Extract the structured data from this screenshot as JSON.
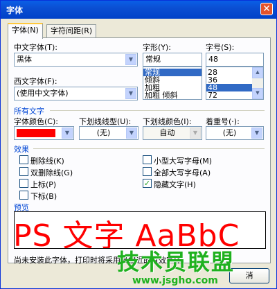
{
  "window": {
    "title": "字体",
    "close_glyph": "✕"
  },
  "tabs": [
    {
      "label": "字体(N)"
    },
    {
      "label": "字符间距(R)"
    }
  ],
  "chinese_font": {
    "label": "中文字体(T):",
    "value": "黑体"
  },
  "western_font": {
    "label": "西文字体(F):",
    "value": "(使用中文字体)"
  },
  "style": {
    "label": "字形(Y):",
    "value": "常规",
    "options": [
      "常规",
      "倾斜",
      "加粗",
      "加粗 倾斜"
    ],
    "selected": "常规"
  },
  "size": {
    "label": "字号(S):",
    "value": "48",
    "options": [
      "28",
      "36",
      "48",
      "72"
    ],
    "selected": "48"
  },
  "all_text": {
    "title": "所有文字",
    "font_color_label": "字体颜色(C):",
    "font_color_value": "#ff0000",
    "underline_style_label": "下划线线型(U):",
    "underline_style_value": "(无)",
    "underline_color_label": "下划线颜色(I):",
    "underline_color_value": "自动",
    "emphasis_label": "着重号(·):",
    "emphasis_value": "(无)"
  },
  "effects": {
    "title": "效果",
    "items": [
      {
        "label": "删除线(K)",
        "checked": false
      },
      {
        "label": "双删除线(G)",
        "checked": false
      },
      {
        "label": "上标(P)",
        "checked": false
      },
      {
        "label": "下标(B)",
        "checked": false
      },
      {
        "label": "小型大写字母(M)",
        "checked": false
      },
      {
        "label": "全部大写字母(A)",
        "checked": false
      },
      {
        "label": "隐藏文字(H)",
        "checked": true
      }
    ]
  },
  "preview": {
    "title": "预览",
    "text": "PS 文字 AaBbC"
  },
  "note": "尚未安装此字体，打印时将采用最相近的有效字体。",
  "buttons": {
    "cancel": "消"
  },
  "watermark": {
    "brand": "技术员联盟",
    "url": "www.jsgho.com"
  },
  "icons": {
    "dropdown": "▼",
    "scroll_up": "▲",
    "scroll_down": "▼",
    "check": "✓"
  }
}
